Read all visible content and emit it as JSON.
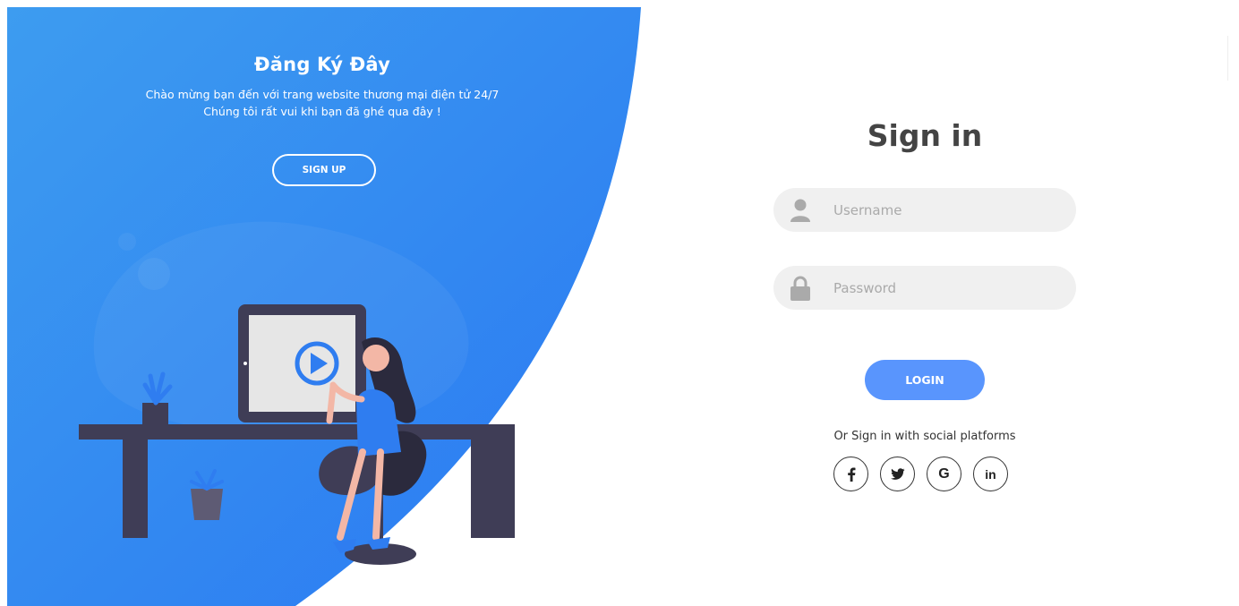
{
  "left_panel": {
    "title": "Đăng Ký Đây",
    "line1": "Chào mừng bạn đến với trang website thương mại điện tử 24/7",
    "line2": "Chúng tôi rất vui khi bạn đã ghé qua đây !",
    "signup_label": "SIGN UP",
    "gradient_start": "#3d9cf0",
    "gradient_end": "#2f7df0"
  },
  "signin": {
    "title": "Sign in",
    "username_placeholder": "Username",
    "password_placeholder": "Password",
    "login_label": "LOGIN",
    "social_text": "Or Sign in with social platforms",
    "social": [
      {
        "name": "facebook-icon",
        "glyph": "f"
      },
      {
        "name": "twitter-icon",
        "glyph": "🐦"
      },
      {
        "name": "google-icon",
        "glyph": "G"
      },
      {
        "name": "linkedin-icon",
        "glyph": "in"
      }
    ],
    "accent": "#5995fd"
  }
}
